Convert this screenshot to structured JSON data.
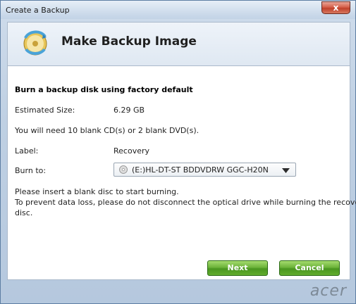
{
  "window": {
    "title": "Create a Backup",
    "close_label": "x"
  },
  "header": {
    "icon": "backup-disc-icon",
    "title": "Make Backup Image"
  },
  "content": {
    "section_title": "Burn a backup disk using factory default",
    "estimated_size_label": "Estimated Size:",
    "estimated_size_value": "6.29 GB",
    "need_text": "You will need 10 blank CD(s) or 2 blank DVD(s).",
    "label_label": "Label:",
    "label_value": "Recovery",
    "burn_to_label": "Burn to:",
    "burn_to_selected": "(E:)HL-DT-ST BDDVDRW GGC-H20N",
    "instruction_1": "Please insert a blank disc to start burning.",
    "instruction_2": "To prevent data loss, please do not disconnect the optical drive while burning the recovery",
    "instruction_3": "disc."
  },
  "buttons": {
    "next": "Next",
    "cancel": "Cancel"
  },
  "footer": {
    "brand": "acer"
  },
  "colors": {
    "button_green": "#5aa62b",
    "close_red": "#c0402b",
    "frame_blue": "#bfd0e3"
  }
}
